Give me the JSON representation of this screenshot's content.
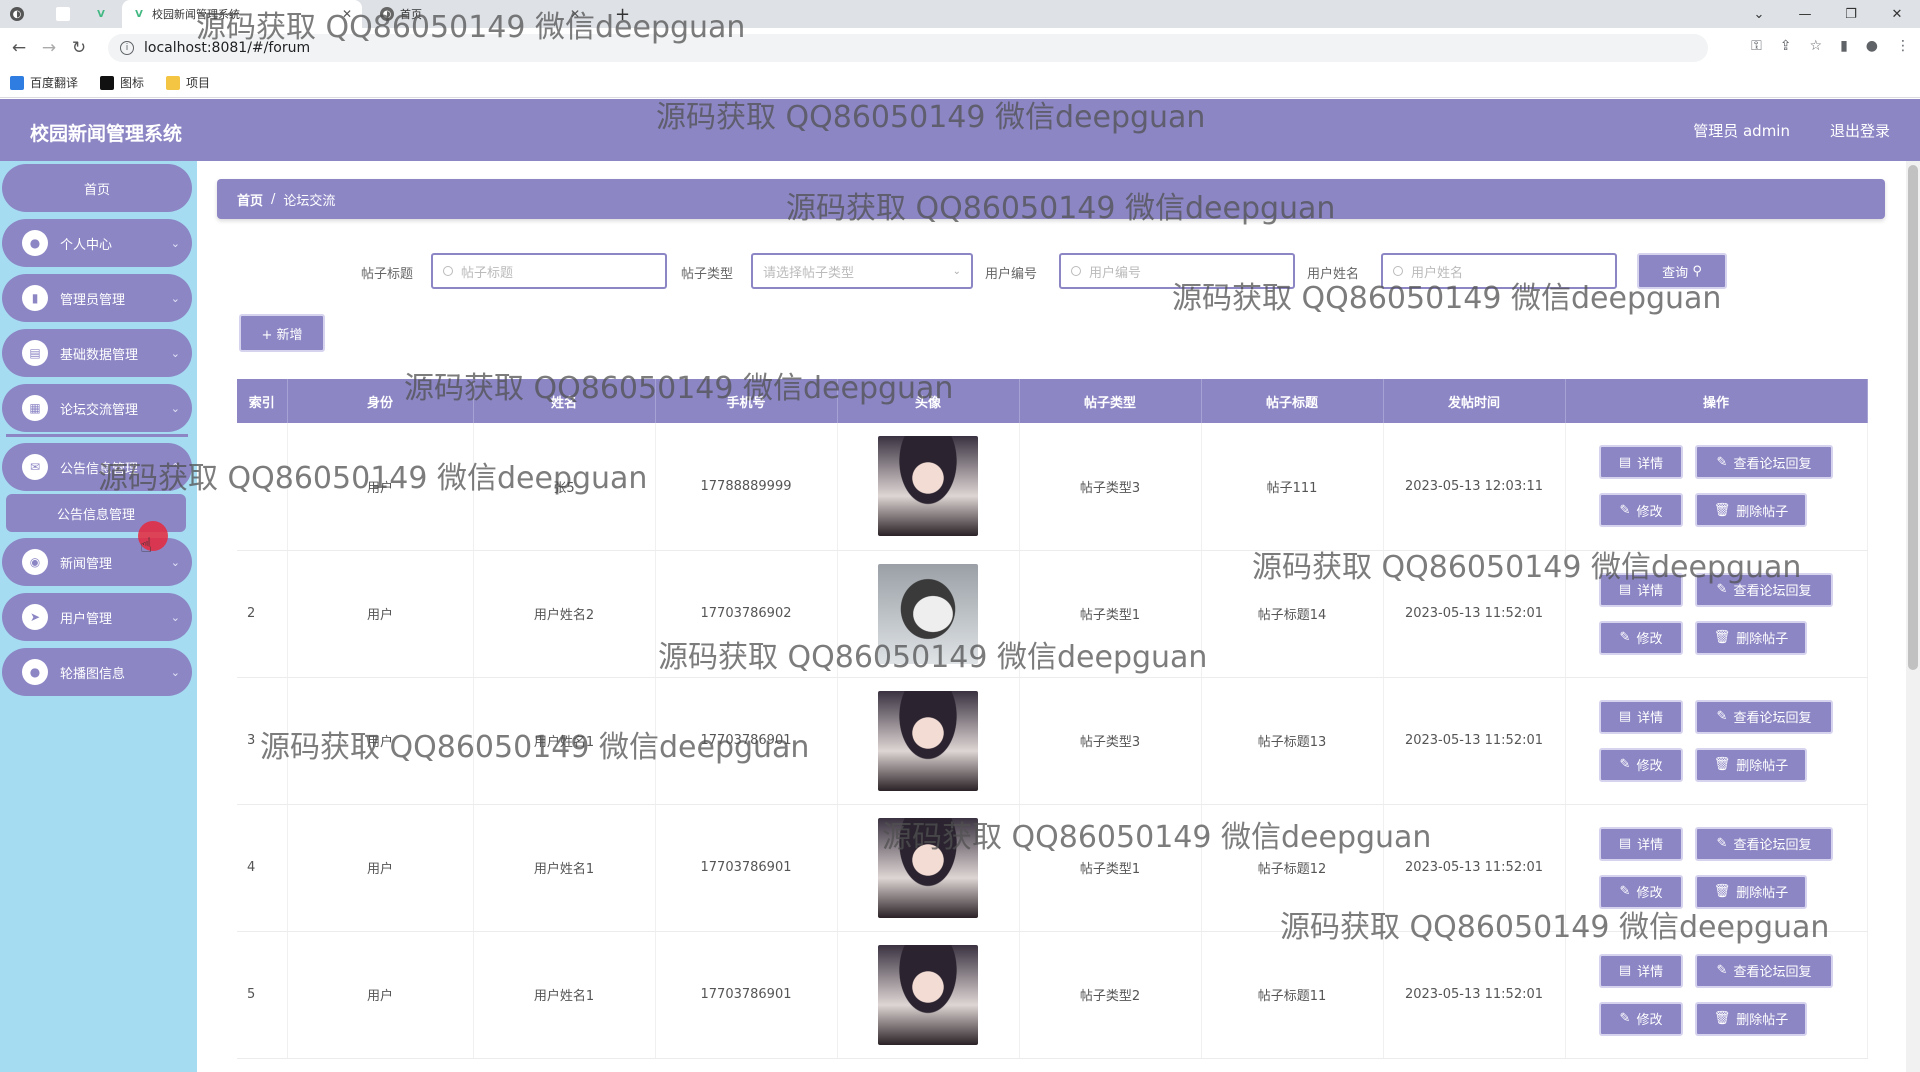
{
  "browser": {
    "tabs": [
      {
        "title": "校园新闻管理系统",
        "active": true
      },
      {
        "title": "首页",
        "active": false
      }
    ],
    "new_tab": "+",
    "url": "localhost:8081/#/forum",
    "bookmarks": [
      "百度翻译",
      "图标",
      "项目"
    ]
  },
  "app": {
    "title": "校园新闻管理系统",
    "admin_label": "管理员 admin",
    "logout": "退出登录",
    "accent": "#8c86c5",
    "sidebar_bg": "#a6dcf2"
  },
  "sidebar": {
    "home": "首页",
    "items": [
      {
        "label": "个人中心",
        "icon": "person-icon"
      },
      {
        "label": "管理员管理",
        "icon": "chart-icon"
      },
      {
        "label": "基础数据管理",
        "icon": "clipboard-icon"
      },
      {
        "label": "论坛交流管理",
        "icon": "grid-icon"
      },
      {
        "label": "公告信息管理",
        "icon": "megaphone-icon"
      },
      {
        "label": "新闻管理",
        "icon": "location-icon"
      },
      {
        "label": "用户管理",
        "icon": "send-icon"
      },
      {
        "label": "轮播图信息",
        "icon": "person-icon"
      }
    ],
    "sub_item": "公告信息管理"
  },
  "breadcrumb": {
    "home": "首页",
    "sep": "/",
    "current": "论坛交流"
  },
  "filters": {
    "title_label": "帖子标题",
    "title_placeholder": "帖子标题",
    "type_label": "帖子类型",
    "type_placeholder": "请选择帖子类型",
    "userno_label": "用户编号",
    "userno_placeholder": "用户编号",
    "username_label": "用户姓名",
    "username_placeholder": "用户姓名",
    "query": "查询"
  },
  "add_button": "+ 新增",
  "table": {
    "headers": [
      "索引",
      "身份",
      "姓名",
      "手机号",
      "头像",
      "帖子类型",
      "帖子标题",
      "发帖时间",
      "操作"
    ],
    "rows": [
      {
        "index": "",
        "role": "用户",
        "name": "张5",
        "phone": "17788889999",
        "avatar": "girl",
        "type": "帖子类型3",
        "title": "帖子111",
        "time": "2023-05-13 12:03:11"
      },
      {
        "index": "2",
        "role": "用户",
        "name": "用户姓名2",
        "phone": "17703786902",
        "avatar": "dog",
        "type": "帖子类型1",
        "title": "帖子标题14",
        "time": "2023-05-13 11:52:01"
      },
      {
        "index": "3",
        "role": "用户",
        "name": "用户姓名1",
        "phone": "17703786901",
        "avatar": "girl",
        "type": "帖子类型3",
        "title": "帖子标题13",
        "time": "2023-05-13 11:52:01"
      },
      {
        "index": "4",
        "role": "用户",
        "name": "用户姓名1",
        "phone": "17703786901",
        "avatar": "girl",
        "type": "帖子类型1",
        "title": "帖子标题12",
        "time": "2023-05-13 11:52:01"
      },
      {
        "index": "5",
        "role": "用户",
        "name": "用户姓名1",
        "phone": "17703786901",
        "avatar": "girl",
        "type": "帖子类型2",
        "title": "帖子标题11",
        "time": "2023-05-13 11:52:01"
      }
    ],
    "actions": {
      "detail": "详情",
      "reply": "查看论坛回复",
      "edit": "修改",
      "delete": "删除帖子"
    }
  },
  "watermark": "源码获取 QQ86050149 微信deepguan"
}
